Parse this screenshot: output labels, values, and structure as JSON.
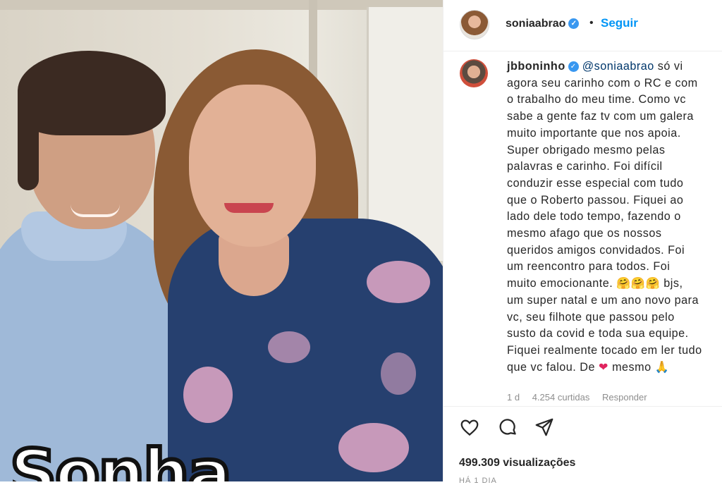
{
  "post": {
    "author": "soniaabrao",
    "follow_label": "Seguir",
    "overlay_text": "Sonha"
  },
  "comment": {
    "author": "jbboninho",
    "mention": "@soniaabrao",
    "lines": [
      "só vi",
      "agora seu carinho com o RC e com",
      "o trabalho do meu time. Como vc",
      "sabe a gente faz tv com um galera",
      "muito importante que nos apoia.",
      "Super obrigado mesmo pelas",
      "palavras e carinho. Foi difícil",
      "conduzir esse especial com tudo",
      "que o Roberto passou. Fiquei ao",
      "lado dele todo tempo, fazendo o",
      "mesmo afago que os nossos",
      "queridos amigos convidados. Foi",
      "um reencontro para todos. Foi",
      "muito emocionante.",
      "bjs,",
      "um super natal e um ano novo para",
      "vc, seu filhote que passou pelo",
      "susto da covid e toda sua equipe.",
      "Fiquei realmente tocado em ler tudo",
      "que vc falou. De",
      "mesmo"
    ],
    "emoji_hug": "🤗🤗🤗",
    "emoji_heart": "❤",
    "emoji_pray": "🙏",
    "age": "1 d",
    "likes": "4.254 curtidas",
    "reply_label": "Responder"
  },
  "stats": {
    "views": "499.309 visualizações",
    "time": "HÁ 1 DIA"
  },
  "icons": {
    "verified": "verified-badge-icon",
    "like": "heart-outline-icon",
    "comment": "comment-bubble-icon",
    "share": "paper-plane-icon"
  },
  "colors": {
    "accent": "#0095f6",
    "verified": "#3897f0",
    "text": "#262626",
    "muted": "#8e8e8e"
  }
}
